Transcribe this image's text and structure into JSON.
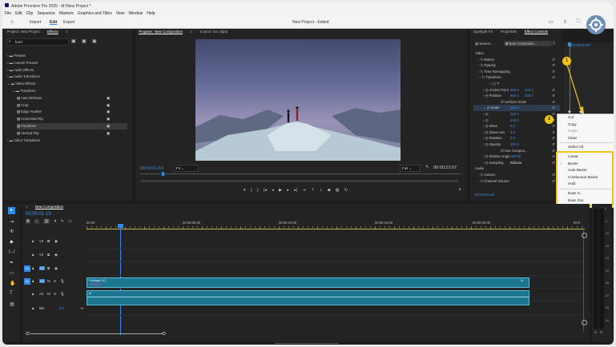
{
  "app": {
    "title": "Adobe Premiere Pro 2025 - M:\\New Project *"
  },
  "menu": [
    "File",
    "Edit",
    "Clip",
    "Sequence",
    "Markers",
    "Graphics and Titles",
    "View",
    "Window",
    "Help"
  ],
  "workspace": {
    "tabs": [
      "Import",
      "Edit",
      "Export"
    ],
    "active": "Edit",
    "project_title": "New Project - Edited"
  },
  "project_panel": {
    "tabs": [
      "Project: New Project",
      "Effects"
    ],
    "search_value": "fund",
    "tree": [
      {
        "label": "Presets",
        "depth": 0
      },
      {
        "label": "Lumetri Presets",
        "depth": 0
      },
      {
        "label": "Audio Effects",
        "depth": 0
      },
      {
        "label": "Audio Transitions",
        "depth": 0
      },
      {
        "label": "Video Effects",
        "depth": 0,
        "open": true
      },
      {
        "label": "Transform",
        "depth": 1,
        "open": true
      },
      {
        "label": "Auto Reframe",
        "depth": 2
      },
      {
        "label": "Crop",
        "depth": 2
      },
      {
        "label": "Edge Feather",
        "depth": 2
      },
      {
        "label": "Horizontal Flip",
        "depth": 2
      },
      {
        "label": "Transform",
        "depth": 2,
        "selected": true
      },
      {
        "label": "Vertical Flip",
        "depth": 2
      },
      {
        "label": "Video Transitions",
        "depth": 0
      }
    ]
  },
  "program_monitor": {
    "tabs": [
      "Program: New Composition",
      "Source: (no clips)"
    ],
    "timecode": "00:00:01:19",
    "fit": "Fit",
    "quality": "Full",
    "duration": "00:00:22:07"
  },
  "effect_controls": {
    "tabs": [
      "Spotlight FX",
      "Properties",
      "Effect Controls"
    ],
    "source_label": "Source: ...",
    "comp_label": "New Compositio...",
    "timecode": "00:00:02:00",
    "bottom_timecode": "00:00:01:19",
    "rows": [
      {
        "label": "Video",
        "kind": "section"
      },
      {
        "label": "Motion",
        "kind": "fx"
      },
      {
        "label": "Opacity",
        "kind": "fx"
      },
      {
        "label": "Time Remapping",
        "kind": "fx"
      },
      {
        "label": "Transform",
        "kind": "fx-open"
      },
      {
        "label": "",
        "kind": "icons"
      },
      {
        "label": "Anchor Point",
        "v1": "960.0",
        "v2": "540.0",
        "kind": "prop"
      },
      {
        "label": "Position",
        "v1": "960.0",
        "v2": "540.0",
        "kind": "prop"
      },
      {
        "label": "Uniform Scale",
        "kind": "check"
      },
      {
        "label": "Scale",
        "v1": "122.0",
        "kind": "prop-open"
      },
      {
        "label": "",
        "v1": "100.0",
        "kind": "prop"
      },
      {
        "label": "",
        "v1": "100.0",
        "kind": "prop"
      },
      {
        "label": "Skew",
        "v1": "0.0",
        "kind": "prop"
      },
      {
        "label": "Skew Axis",
        "v1": "0.0",
        "kind": "prop"
      },
      {
        "label": "Rotation",
        "v1": "0.0",
        "kind": "prop"
      },
      {
        "label": "Opacity",
        "v1": "100.0",
        "kind": "prop"
      },
      {
        "label": "Use Compos...",
        "kind": "check"
      },
      {
        "label": "Shutter Angle",
        "v1": "180.00",
        "kind": "prop"
      },
      {
        "label": "Sampling",
        "v1": "Bilinear",
        "kind": "select"
      },
      {
        "label": "Audio",
        "kind": "section"
      },
      {
        "label": "Volume",
        "kind": "fx"
      },
      {
        "label": "Channel Volume",
        "kind": "fx"
      }
    ]
  },
  "context_menu": {
    "items": [
      {
        "label": "Cut",
        "disabled": false
      },
      {
        "label": "Copy",
        "disabled": false
      },
      {
        "label": "Paste",
        "disabled": true
      },
      {
        "label": "Clear",
        "disabled": false
      },
      {
        "sep": true
      },
      {
        "label": "Select All",
        "disabled": false
      },
      {
        "sep": true
      },
      {
        "label": "Linear",
        "disabled": false
      },
      {
        "label": "Bezier",
        "disabled": false,
        "checked": true
      },
      {
        "label": "Auto Bezier",
        "disabled": false
      },
      {
        "label": "Continuous Bezier",
        "disabled": false
      },
      {
        "label": "Hold",
        "disabled": false
      },
      {
        "sep": true
      },
      {
        "label": "Ease In",
        "disabled": false
      },
      {
        "label": "Ease Out",
        "disabled": false
      }
    ]
  },
  "badges": [
    "1",
    "2"
  ],
  "timeline": {
    "tab": "New Composition",
    "timecode": "00:00:01:19",
    "ruler": [
      "00:00",
      "00:00:05:00",
      "00:00:10:00",
      "00:00:15:00",
      "00:00:20:00",
      "00:0"
    ],
    "tracks": [
      {
        "name": "V3",
        "kind": "video"
      },
      {
        "name": "V2",
        "kind": "video"
      },
      {
        "name": "V1",
        "kind": "video"
      },
      {
        "name": "A1",
        "kind": "audio"
      },
      {
        "name": "A2",
        "kind": "audio"
      },
      {
        "name": "Mix",
        "kind": "mix",
        "value": "0.0"
      }
    ],
    "clip_label": "Footage [V]",
    "meter_labels": [
      "0",
      "-6",
      "-12",
      "-18",
      "-24",
      "-30",
      "-36",
      "-42",
      "-48",
      "-54"
    ],
    "meter_footer": [
      "S",
      "S"
    ]
  },
  "colors": {
    "accent": "#2d8ceb",
    "clip": "#1c7690",
    "badge": "#f2c417",
    "highlight": "#f2c417"
  }
}
